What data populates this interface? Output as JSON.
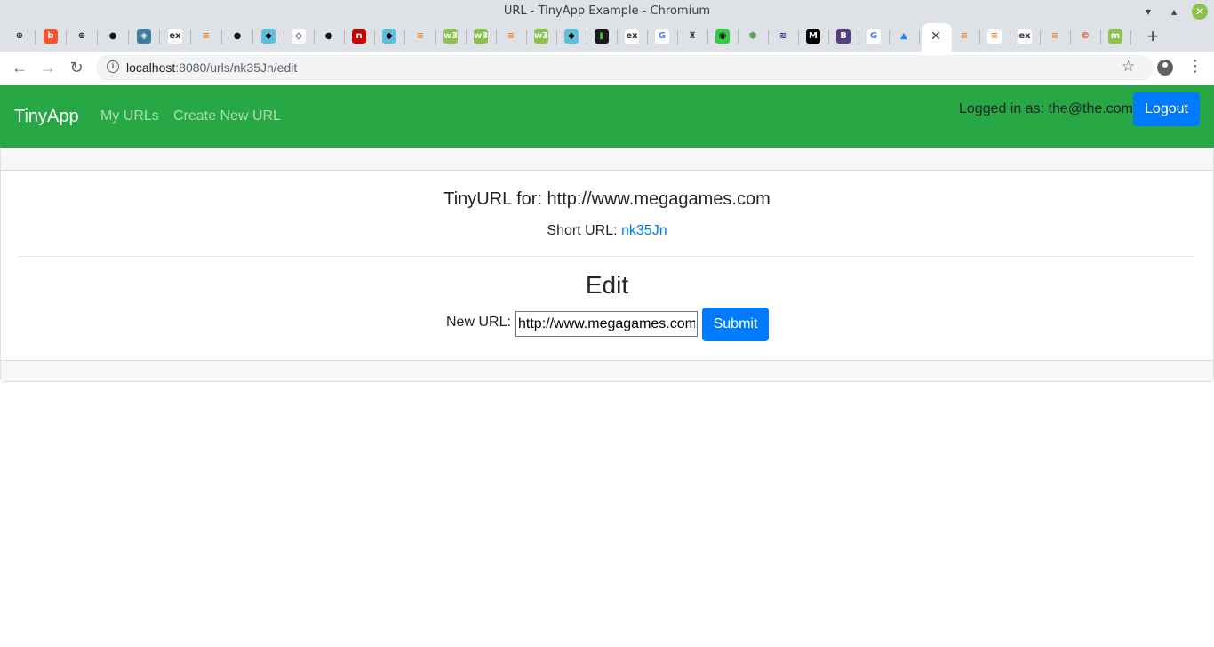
{
  "window": {
    "title": "URL - TinyApp Example - Chromium",
    "minimize_glyph": "▾",
    "maximize_glyph": "▴",
    "close_glyph": "✕"
  },
  "tabs": [
    {
      "icon": "chromium-icon",
      "glyph": "⊕",
      "bg": "#dee1e6",
      "fg": "#202124"
    },
    {
      "icon": "brave-icon",
      "glyph": "b",
      "bg": "#fb542b",
      "fg": "#ffffff"
    },
    {
      "icon": "chromium-icon",
      "glyph": "⊕",
      "bg": "#dee1e6",
      "fg": "#202124"
    },
    {
      "icon": "github-icon",
      "glyph": "●",
      "bg": "#dee1e6",
      "fg": "#181717"
    },
    {
      "icon": "shield-icon",
      "glyph": "◈",
      "bg": "#3b7ea1",
      "fg": "#ffffff"
    },
    {
      "icon": "expressjs-icon",
      "glyph": "ex",
      "bg": "#ffffff",
      "fg": "#333333"
    },
    {
      "icon": "stackoverflow-icon",
      "glyph": "≡",
      "bg": "#dee1e6",
      "fg": "#f48024"
    },
    {
      "icon": "github-icon",
      "glyph": "●",
      "bg": "#dee1e6",
      "fg": "#181717"
    },
    {
      "icon": "bird-icon",
      "glyph": "◆",
      "bg": "#5bc0de",
      "fg": "#000000"
    },
    {
      "icon": "codepen-icon",
      "glyph": "◇",
      "bg": "#ffffff",
      "fg": "#000000"
    },
    {
      "icon": "github-icon",
      "glyph": "●",
      "bg": "#dee1e6",
      "fg": "#181717"
    },
    {
      "icon": "netlify-icon",
      "glyph": "n",
      "bg": "#cc0000",
      "fg": "#ffffff"
    },
    {
      "icon": "bird-icon",
      "glyph": "◆",
      "bg": "#5bc0de",
      "fg": "#000000"
    },
    {
      "icon": "stackoverflow-icon",
      "glyph": "≡",
      "bg": "#dee1e6",
      "fg": "#f48024"
    },
    {
      "icon": "w3schools-icon",
      "glyph": "w3",
      "bg": "#8bc34a",
      "fg": "#ffffff"
    },
    {
      "icon": "w3schools-icon",
      "glyph": "w3",
      "bg": "#8bc34a",
      "fg": "#ffffff"
    },
    {
      "icon": "stackoverflow-icon",
      "glyph": "≡",
      "bg": "#dee1e6",
      "fg": "#f48024"
    },
    {
      "icon": "w3schools-icon",
      "glyph": "w3",
      "bg": "#8bc34a",
      "fg": "#ffffff"
    },
    {
      "icon": "bird-icon",
      "glyph": "◆",
      "bg": "#5bc0de",
      "fg": "#000000"
    },
    {
      "icon": "mongodb-icon",
      "glyph": "▮",
      "bg": "#1a1a1a",
      "fg": "#4db33d"
    },
    {
      "icon": "expressjs-icon",
      "glyph": "ex",
      "bg": "#ffffff",
      "fg": "#333333"
    },
    {
      "icon": "google-icon",
      "glyph": "G",
      "bg": "#ffffff",
      "fg": "#4285f4"
    },
    {
      "icon": "mustache-icon",
      "glyph": "♜",
      "bg": "#dee1e6",
      "fg": "#333333"
    },
    {
      "icon": "robot-icon",
      "glyph": "◉",
      "bg": "#2ecc40",
      "fg": "#000000"
    },
    {
      "icon": "nodejs-icon",
      "glyph": "⬢",
      "bg": "#dee1e6",
      "fg": "#68a063"
    },
    {
      "icon": "stripes-icon",
      "glyph": "≋",
      "bg": "#dee1e6",
      "fg": "#1a237e"
    },
    {
      "icon": "medium-icon",
      "glyph": "M",
      "bg": "#000000",
      "fg": "#ffffff"
    },
    {
      "icon": "bootstrap-icon",
      "glyph": "B",
      "bg": "#563d7c",
      "fg": "#ffffff"
    },
    {
      "icon": "google-icon",
      "glyph": "G",
      "bg": "#ffffff",
      "fg": "#4285f4"
    },
    {
      "icon": "atlassian-icon",
      "glyph": "▲",
      "bg": "#dee1e6",
      "fg": "#2684ff"
    },
    {
      "icon": "close-icon",
      "glyph": "✕",
      "bg": "transparent",
      "fg": "#3c4043",
      "active": true
    },
    {
      "icon": "stackoverflow-icon",
      "glyph": "≡",
      "bg": "#dee1e6",
      "fg": "#f48024"
    },
    {
      "icon": "stackoverflow-icon",
      "glyph": "≡",
      "bg": "#ffffff",
      "fg": "#f48024"
    },
    {
      "icon": "expressjs-icon",
      "glyph": "ex",
      "bg": "#ffffff",
      "fg": "#333333"
    },
    {
      "icon": "stackoverflow-icon",
      "glyph": "≡",
      "bg": "#dee1e6",
      "fg": "#f48024"
    },
    {
      "icon": "copyright-icon",
      "glyph": "©",
      "bg": "#dee1e6",
      "fg": "#d84315"
    },
    {
      "icon": "linuxmint-icon",
      "glyph": "m",
      "bg": "#8bc34a",
      "fg": "#ffffff"
    }
  ],
  "new_tab_glyph": "+",
  "toolbar": {
    "back_glyph": "←",
    "forward_glyph": "→",
    "reload_glyph": "↻",
    "info_glyph": "i",
    "url_host": "localhost",
    "url_path": ":8080/urls/nk35Jn/edit",
    "star_glyph": "☆",
    "menu_glyph": "⋮"
  },
  "navbar": {
    "brand": "TinyApp",
    "links": [
      "My URLs",
      "Create New URL"
    ],
    "logged_in_text": "Logged in as: the@the.com",
    "logout_label": "Logout",
    "color": "#28a745"
  },
  "card": {
    "tinyurl_title": "TinyURL for: http://www.megagames.com",
    "short_url_label": "Short URL: ",
    "short_url_link": "nk35Jn",
    "edit_heading": "Edit",
    "new_url_label": "New URL:",
    "new_url_value": "http://www.megagames.com",
    "submit_label": "Submit"
  }
}
